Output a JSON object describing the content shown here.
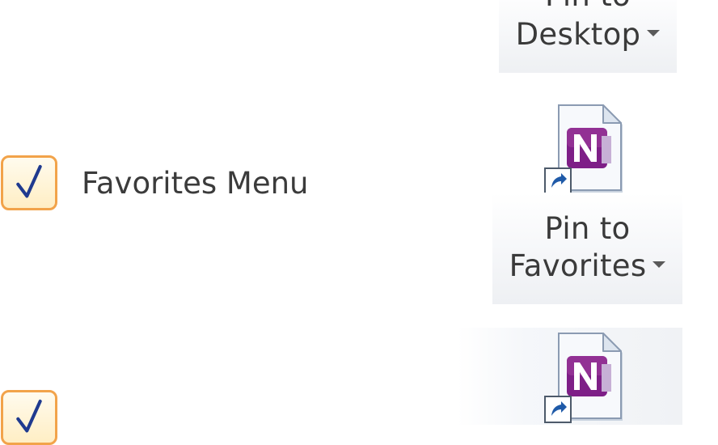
{
  "options": [
    {
      "label": "Favorites Menu",
      "checked": true
    },
    {
      "label": "",
      "checked": true
    }
  ],
  "buttons": {
    "pin_to_desktop": {
      "line1": "Pin to",
      "line2": "Desktop",
      "has_dropdown": true
    },
    "pin_to_favorites": {
      "line1": "Pin to",
      "line2": "Favorites",
      "has_dropdown": true
    }
  },
  "icons": {
    "file": "onenote-shortcut-icon",
    "check": "checkmark-icon",
    "dropdown": "dropdown-arrow-icon"
  },
  "colors": {
    "checkbox_border": "#f2a34a",
    "checkbox_fill": "#ffeec4",
    "onenote_purple": "#8a1f8f",
    "check_blue": "#1f3a8f"
  }
}
